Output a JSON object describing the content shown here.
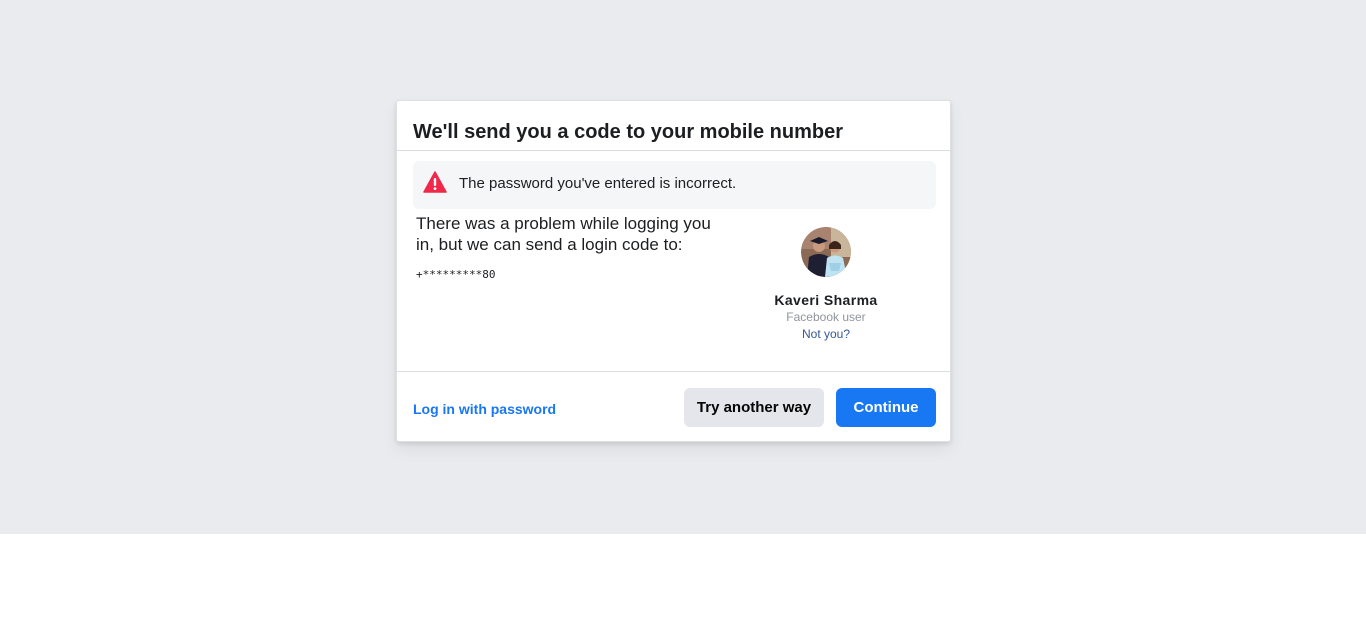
{
  "dialog": {
    "title": "We'll send you a code to your mobile number"
  },
  "alert": {
    "message": "The password you've entered is incorrect.",
    "icon": "warning-icon",
    "color": "#f02849"
  },
  "body": {
    "problem_text": "There was a problem while logging you in, but we can send a login code to:",
    "phone_masked": "+*********80"
  },
  "user": {
    "name": "Kaveri Sharma",
    "subtitle": "Facebook user",
    "not_you_label": "Not you?"
  },
  "footer": {
    "login_with_password_label": "Log in with password",
    "try_another_way_label": "Try another way",
    "continue_label": "Continue"
  },
  "colors": {
    "page_background": "#e9ebee",
    "primary": "#1877f2",
    "link": "#365899"
  }
}
